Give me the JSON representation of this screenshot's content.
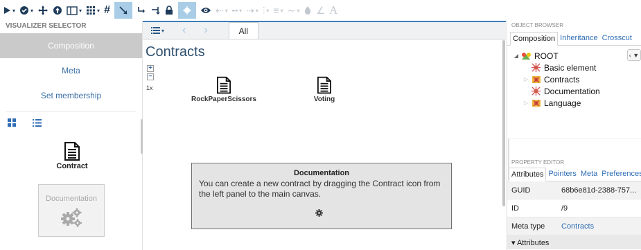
{
  "toolbar": {
    "groups": [
      {
        "icon": "play-icon",
        "caret": true
      },
      {
        "icon": "check-circle-icon",
        "caret": true
      },
      {
        "icon": "move-arrows-icon",
        "caret": false
      },
      {
        "icon": "arrow-up-circle-icon",
        "caret": false
      },
      {
        "icon": "layout-columns-icon",
        "caret": true
      },
      {
        "icon": "grid-icon",
        "caret": true
      },
      {
        "icon": "hash-icon",
        "caret": false
      },
      {
        "icon": "cursor-arrow-icon",
        "caret": false,
        "highlight": true
      },
      {
        "icon": "connect-left-icon",
        "caret": false
      },
      {
        "icon": "connect-right-icon",
        "caret": false
      },
      {
        "icon": "lock-icon",
        "caret": false
      },
      {
        "icon": "crosshair-icon",
        "caret": false,
        "highlight": true
      },
      {
        "icon": "eye-icon",
        "caret": false
      },
      {
        "icon": "arrow-left-icon",
        "caret": true,
        "dim": true
      },
      {
        "icon": "dash-line-icon",
        "caret": true,
        "dim": true
      },
      {
        "icon": "arrow-right-icon",
        "caret": true,
        "dim": true
      },
      {
        "icon": "sliders-icon",
        "caret": true,
        "dim": true
      },
      {
        "icon": "align-icon",
        "caret": true,
        "dim": true
      },
      {
        "icon": "curve-line-icon",
        "caret": true,
        "dim": true
      },
      {
        "icon": "fill-drop-icon",
        "caret": false,
        "dim": true
      },
      {
        "icon": "angle-icon",
        "caret": false,
        "dim": true
      },
      {
        "icon": "font-icon",
        "caret": false,
        "dim": true,
        "text": "A"
      }
    ]
  },
  "visualizer": {
    "title": "VISUALIZER SELECTOR",
    "items": [
      {
        "label": "Composition",
        "active": true
      },
      {
        "label": "Meta",
        "active": false
      },
      {
        "label": "Set membership",
        "active": false
      }
    ],
    "tiles": [
      {
        "label": "Contract",
        "disabled": false
      },
      {
        "label": "Documentation",
        "disabled": true
      }
    ]
  },
  "canvas": {
    "tab_label": "All",
    "title": "Contracts",
    "zoom_level": "1x",
    "zoom_in": "+",
    "zoom_out": "−",
    "nodes": [
      {
        "label": "RockPaperScissors"
      },
      {
        "label": "Voting"
      }
    ],
    "documentation": {
      "title": "Documentation",
      "text": "You can create a new contract by dragging the Contract icon from the left panel to the main canvas."
    }
  },
  "object_browser": {
    "title": "OBJECT BROWSER",
    "tabs": [
      {
        "label": "Composition",
        "active": true
      },
      {
        "label": "Inheritance",
        "active": false
      },
      {
        "label": "Crosscut",
        "active": false
      }
    ],
    "filter_label": "‹ ▼",
    "tree": [
      {
        "label": "ROOT",
        "level": 0,
        "toggle": "◢",
        "icon": "root-icon"
      },
      {
        "label": "Basic element",
        "level": 1,
        "toggle": "",
        "icon": "basic-element-icon"
      },
      {
        "label": "Contracts",
        "level": 1,
        "toggle": "▷",
        "icon": "folder-element-icon"
      },
      {
        "label": "Documentation",
        "level": 1,
        "toggle": "",
        "icon": "basic-element-icon"
      },
      {
        "label": "Language",
        "level": 1,
        "toggle": "▷",
        "icon": "folder-element-icon"
      }
    ]
  },
  "property_editor": {
    "title": "PROPERTY EDITOR",
    "tabs": [
      {
        "label": "Attributes",
        "active": true
      },
      {
        "label": "Pointers",
        "active": false
      },
      {
        "label": "Meta",
        "active": false
      },
      {
        "label": "Preferences",
        "active": false
      }
    ],
    "rows": [
      {
        "key": "GUID",
        "value": "68b6e81d-2388-757...",
        "link": false
      },
      {
        "key": "ID",
        "value": "/9",
        "link": false
      },
      {
        "key": "Meta type",
        "value": "Contracts",
        "link": true
      }
    ],
    "section": "▾ Attributes"
  },
  "colors": {
    "accent": "#3b7fb9",
    "link": "#2f6db5",
    "active_visualizer": "#cacaca",
    "toolbar_icon": "#1e3b5a"
  }
}
